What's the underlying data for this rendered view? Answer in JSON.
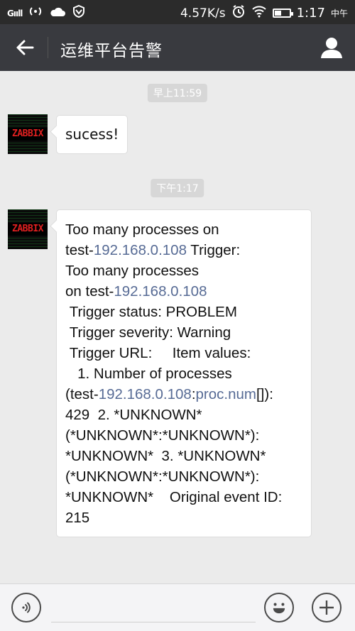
{
  "status_bar": {
    "signal_label": "Gııll",
    "network_speed": "4.57K/s",
    "time": "1:17",
    "time_suffix": "中午",
    "battery_level": 0.45
  },
  "header": {
    "title": "运维平台告警"
  },
  "messages": [
    {
      "timestamp": "早上11:59",
      "sender_label": "ZABBIX",
      "text": "sucess!"
    },
    {
      "timestamp": "下午1:17",
      "sender_label": "ZABBIX",
      "segments": [
        "Too many processes on\ntest-",
        "192.168.0.108",
        " Trigger:\nToo many processes\non test-",
        "192.168.0.108",
        "\n Trigger status: PROBLEM\n Trigger severity: Warning\n Trigger URL:     Item values:\n   1. Number of processes\n(test-",
        "192.168.0.108",
        ":",
        "proc.num",
        "[]):\n429  2. *UNKNOWN*\n(*UNKNOWN*:*UNKNOWN*):\n*UNKNOWN*  3. *UNKNOWN*\n(*UNKNOWN*:*UNKNOWN*):\n*UNKNOWN*    Original event ID:\n215"
      ]
    }
  ],
  "icons": {
    "back": "arrow-left-icon",
    "user": "person-icon",
    "voice": "voice-icon",
    "emoji": "emoji-icon",
    "plus": "plus-icon"
  },
  "colors": {
    "link": "#576b95",
    "header_bg": "#393a3f",
    "chat_bg": "#ebebeb"
  }
}
